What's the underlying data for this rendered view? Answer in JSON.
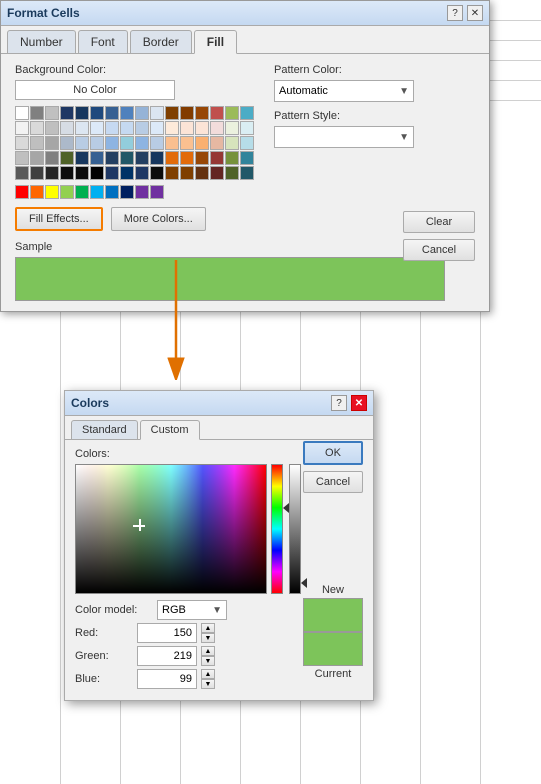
{
  "spreadsheet": {
    "background": "#ffffff"
  },
  "formatCells": {
    "title": "Format Cells",
    "tabs": [
      {
        "label": "Number",
        "active": false
      },
      {
        "label": "Font",
        "active": false
      },
      {
        "label": "Border",
        "active": false
      },
      {
        "label": "Fill",
        "active": true
      }
    ],
    "backgroundColorLabel": "Background Color:",
    "noColorButton": "No Color",
    "patternColorLabel": "Pattern Color:",
    "patternColorValue": "Automatic",
    "patternStyleLabel": "Pattern Style:",
    "fillEffectsButton": "Fill Effects...",
    "moreColorsButton": "More Colors...",
    "sampleLabel": "Sample",
    "sampleColor": "#7dc45a",
    "clearButton": "Clear",
    "cancelButton": "Cancel"
  },
  "colorsDialog": {
    "title": "Colors",
    "tabs": [
      {
        "label": "Standard",
        "active": false
      },
      {
        "label": "Custom",
        "active": true
      }
    ],
    "colorsLabel": "Colors:",
    "colorModelLabel": "Color model:",
    "colorModelValue": "RGB",
    "redLabel": "Red:",
    "redValue": "150",
    "greenLabel": "Green:",
    "greenValue": "219",
    "blueLabel": "Blue:",
    "blueValue": "99",
    "newLabel": "New",
    "currentLabel": "Current",
    "newColor": "#7dc45a",
    "currentColor": "#7dc45a",
    "okButton": "OK",
    "cancelButton": "Cancel"
  },
  "colorGrid": {
    "row1": [
      "#ffffff",
      "#000000",
      "#000000",
      "#1f3864",
      "#17375e",
      "#1f497d",
      "#376092",
      "#4f81bd",
      "#95b3d7",
      "#dbe5f1",
      "#7f3f00",
      "#823c00",
      "#974706",
      "#c0504d",
      "#9bbb59",
      "#4bacc6",
      "#1f497d",
      "#17375e",
      "#1f3864",
      "#ffffff"
    ],
    "standardColors": [
      "#ff0000",
      "#ff6600",
      "#ffff00",
      "#92d050",
      "#00b050",
      "#00b0f0",
      "#0070c0",
      "#002060",
      "#7030a0",
      "#ffffff"
    ]
  }
}
